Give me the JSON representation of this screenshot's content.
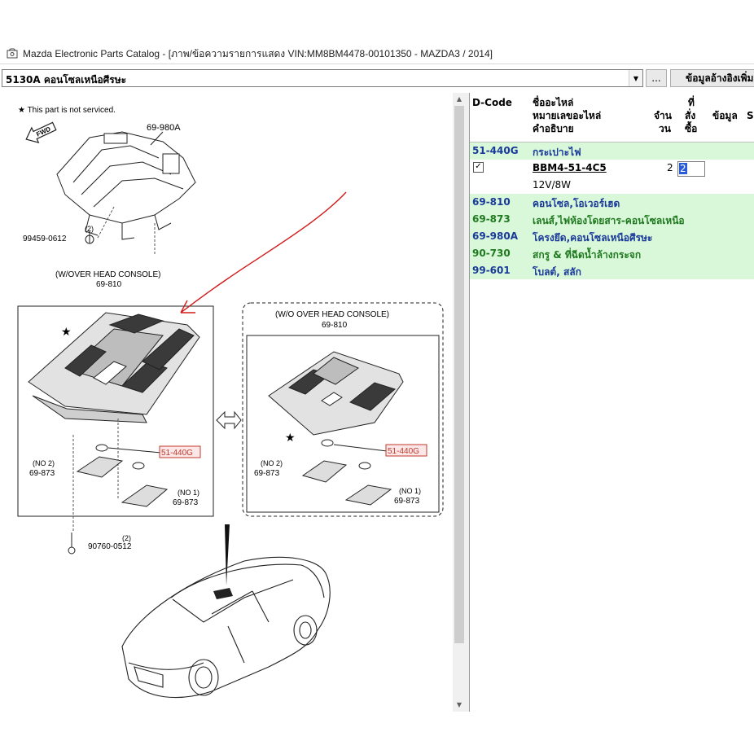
{
  "window": {
    "title": "Mazda Electronic Parts Catalog - [ภาพ/ข้อความรายการแสดง VIN:MM8BM4478-00101350 - MAZDA3 / 2014]",
    "app_icon": "catalog-icon"
  },
  "toolbar": {
    "section_value": "5130A  คอนโซลเหนือศีรษะ",
    "browse_label": "...",
    "reference_label": "ข้อมูลอ้างอิงเพิ่ม"
  },
  "diagram": {
    "note": "★ This part is not serviced.",
    "fwd_label": "FWD",
    "labels": {
      "frame": "69-980A",
      "screw_top_qty": "(2)",
      "screw_top": "99459-0612",
      "with_console": "(W/OVER HEAD CONSOLE)",
      "with_console_code": "69-810",
      "without_console": "(W/O OVER HEAD CONSOLE)",
      "without_console_code": "69-810",
      "bulb_left": "51-440G",
      "bulb_right": "51-440G",
      "lens_no2_left": "(NO 2)",
      "lens_no2_left_code": "69-873",
      "lens_no1_left": "(NO 1)",
      "lens_no1_left_code": "69-873",
      "lens_no2_right": "(NO 2)",
      "lens_no2_right_code": "69-873",
      "lens_no1_right": "(NO 1)",
      "lens_no1_right_code": "69-873",
      "screw_bottom_qty": "(2)",
      "screw_bottom": "90760-0512"
    }
  },
  "grid": {
    "headers": {
      "dcode": "D-Code",
      "name1": "ชื่ออะไหล่",
      "name2": "หมายเลขอะไหล่",
      "name3": "คำอธิบาย",
      "qty1": "จำน",
      "qty2": "วน",
      "order1": "ที่",
      "order2": "สั่ง",
      "order3": "ซื้อ",
      "info": "ข้อมูล",
      "extra": "S"
    },
    "rows": [
      {
        "code": "51-440G",
        "name": "กระเปาะไฟ"
      },
      {
        "code": "69-810",
        "name": "คอนโซล,โอเวอร์เฮด"
      },
      {
        "code": "69-873",
        "name": "เลนส์,ไฟห้องโดยสาร-คอนโซลเหนือ"
      },
      {
        "code": "69-980A",
        "name": "โครงยึด,คอนโซลเหนือศีรษะ"
      },
      {
        "code": "90-730",
        "name": "สกรู & ที่ฉีดน้ำล้างกระจก"
      },
      {
        "code": "99-601",
        "name": "โบลต์, สลัก"
      }
    ],
    "selected": {
      "checked": "✓",
      "part_number": "BBM4-51-4C5",
      "description": "12V/8W",
      "quantity": "2",
      "order_value": "2"
    }
  },
  "colors": {
    "row_bg": "#d9f7d9",
    "code_blue": "#1a3a9a",
    "code_green": "#1f7a1f",
    "callout_red": "#d11a1a",
    "highlight_box": "#c0392b"
  }
}
